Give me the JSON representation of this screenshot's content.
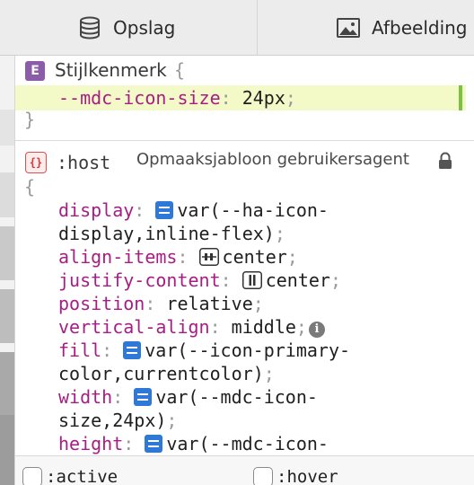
{
  "tabs": [
    {
      "label": "Opslag",
      "icon": "database-icon"
    },
    {
      "label": "Afbeelding",
      "icon": "image-icon"
    }
  ],
  "rules": {
    "element_style": {
      "badge": "E",
      "selector": "Stijlkenmerk",
      "open_brace": "{",
      "close_brace": "}",
      "declaration": {
        "property": "--mdc-icon-size",
        "value": "24px"
      }
    },
    "host": {
      "badge": "{}",
      "selector": ":host",
      "origin": "Opmaaksjabloon gebruikersagent",
      "open_brace": "{",
      "declarations": {
        "display": {
          "property": "display",
          "value_line1": "var(--ha-icon-",
          "value_line2": "display,inline-flex)"
        },
        "align_items": {
          "property": "align-items",
          "value": "center"
        },
        "justify_content": {
          "property": "justify-content",
          "value": "center"
        },
        "position": {
          "property": "position",
          "value": "relative"
        },
        "vertical_align": {
          "property": "vertical-align",
          "value": "middle"
        },
        "fill": {
          "property": "fill",
          "value_line1": "var(--icon-primary-",
          "value_line2": "color,currentcolor)"
        },
        "width": {
          "property": "width",
          "value_line1": "var(--mdc-icon-",
          "value_line2": "size,24px)"
        },
        "height": {
          "property": "height",
          "value_line1": "var(--mdc-icon-"
        }
      }
    }
  },
  "pseudo_states": [
    {
      "label": ":active"
    },
    {
      "label": ":hover"
    }
  ],
  "colors": {
    "property": "#a61e83",
    "var_badge": "#2e78d8",
    "highlight": "#f4f9c8",
    "changed_marker": "#7cc242",
    "element_badge": "#8b5ca8",
    "host_badge": "#e05050"
  }
}
